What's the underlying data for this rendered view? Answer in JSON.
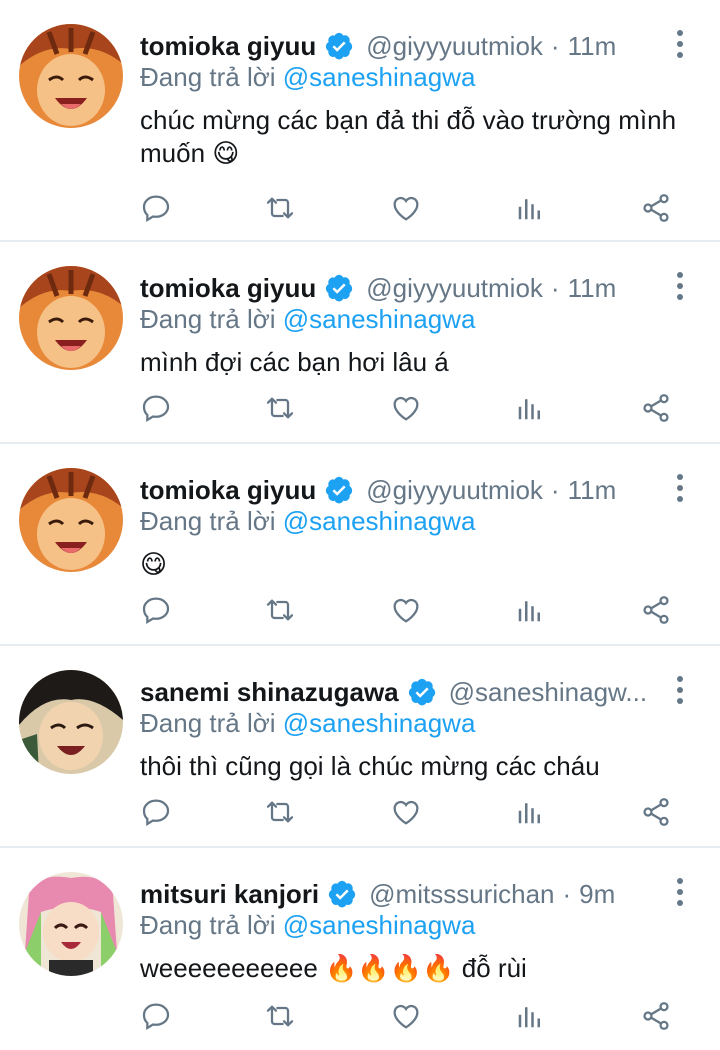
{
  "reply_prefix": "Đang trả lời ",
  "colors": {
    "accent": "#1da1f2",
    "muted": "#657786",
    "text": "#14171a",
    "divider": "#e6ecf0"
  },
  "tweets": [
    {
      "name": "tomioka giyuu",
      "handle": "@giyyyuutmiok",
      "time": "11m",
      "reply_to": "@saneshinagwa",
      "text": "chúc mừng các bạn đả thi đỗ vào trường mình muốn 😋",
      "avatar": "orange-anime-avatar"
    },
    {
      "name": "tomioka giyuu",
      "handle": "@giyyyuutmiok",
      "time": "11m",
      "reply_to": "@saneshinagwa",
      "text": "mình đợi các bạn hơi lâu á",
      "avatar": "orange-anime-avatar"
    },
    {
      "name": "tomioka giyuu",
      "handle": "@giyyyuutmiok",
      "time": "11m",
      "reply_to": "@saneshinagwa",
      "text": "😋",
      "avatar": "orange-anime-avatar"
    },
    {
      "name": "sanemi shinazugawa",
      "handle": "@saneshinagw...",
      "time": "",
      "reply_to": "@saneshinagwa",
      "text": "thôi thì cũng gọi là chúc mừng các cháu",
      "avatar": "dark-anime-avatar"
    },
    {
      "name": "mitsuri kanjori",
      "handle": "@mitsssurichan",
      "time": "9m",
      "reply_to": "@saneshinagwa",
      "text": "weeeeeeeeeee 🔥🔥🔥🔥 đỗ rùi",
      "avatar": "pink-anime-avatar"
    }
  ],
  "action_icons": [
    "reply-icon",
    "retweet-icon",
    "like-icon",
    "analytics-icon",
    "share-icon"
  ]
}
